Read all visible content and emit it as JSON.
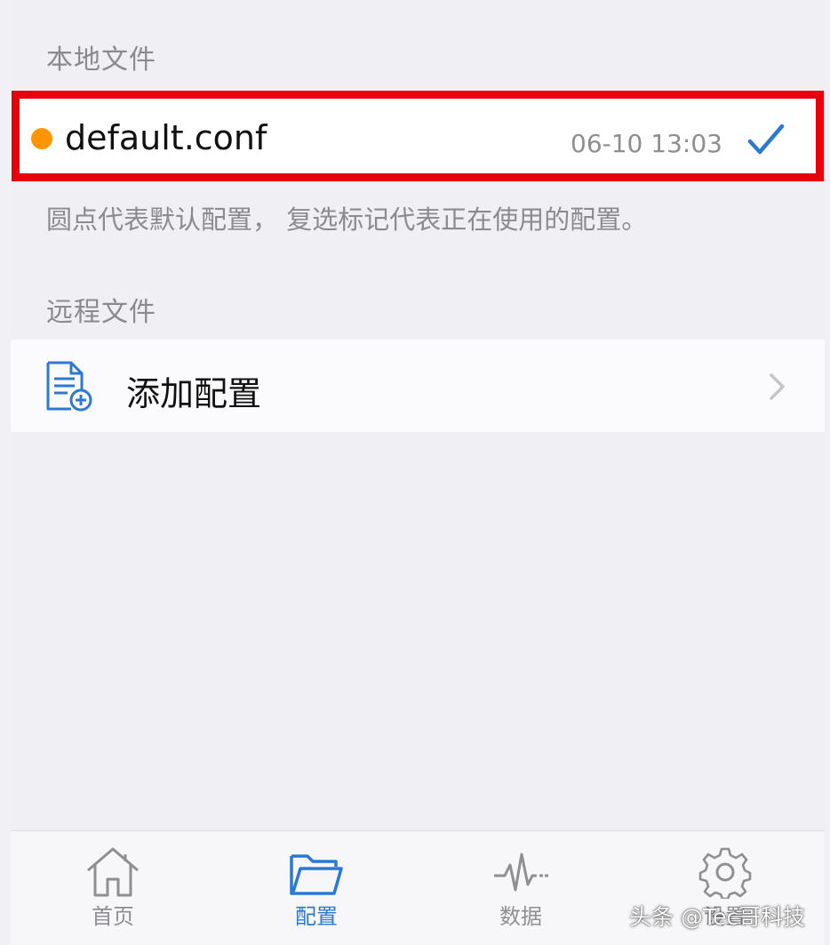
{
  "local_files": {
    "header": "本地文件",
    "items": [
      {
        "name": "default.conf",
        "time": "06-10 13:03",
        "is_default": true,
        "is_active": true
      }
    ],
    "footnote": "圆点代表默认配置， 复选标记代表正在使用的配置。"
  },
  "remote_files": {
    "header": "远程文件",
    "add_label": "添加配置"
  },
  "tabbar": {
    "tabs": [
      {
        "label": "首页",
        "icon": "home-icon",
        "active": false
      },
      {
        "label": "配置",
        "icon": "folder-icon",
        "active": true
      },
      {
        "label": "数据",
        "icon": "pulse-icon",
        "active": false
      },
      {
        "label": "设置",
        "icon": "gear-icon",
        "active": false
      }
    ]
  },
  "watermark": "头条 @Tec哥科技",
  "colors": {
    "accent": "#2b79d4",
    "default_dot": "#ff9500",
    "highlight": "#e8000b",
    "secondary_text": "#8e8e93"
  }
}
